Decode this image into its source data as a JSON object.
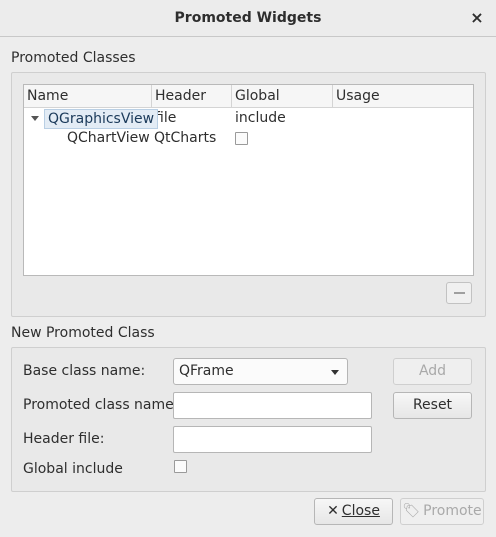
{
  "window": {
    "title": "Promoted Widgets",
    "close_glyph": "×"
  },
  "promoted_classes": {
    "section_label": "Promoted Classes",
    "columns": [
      "Name",
      "Header file",
      "Global include",
      "Usage"
    ],
    "parent": {
      "name": "QGraphicsView",
      "expanded": true
    },
    "rows": [
      {
        "name": "QChartView",
        "header_file": "QtCharts",
        "global_include": false,
        "usage": ""
      }
    ],
    "remove_button_icon": "minus-icon"
  },
  "new_promoted_class": {
    "section_label": "New Promoted Class",
    "base_class_label": "Base class name:",
    "base_class_value": "QFrame",
    "promoted_class_label": "Promoted class name:",
    "promoted_class_value": "",
    "header_file_label": "Header file:",
    "header_file_value": "",
    "global_include_label": "Global include",
    "global_include_checked": false,
    "add_label": "Add",
    "reset_label": "Reset"
  },
  "footer": {
    "close_label": "Close",
    "close_icon": "x-icon",
    "promote_label": "Promote",
    "promote_icon": "tag-icon"
  }
}
